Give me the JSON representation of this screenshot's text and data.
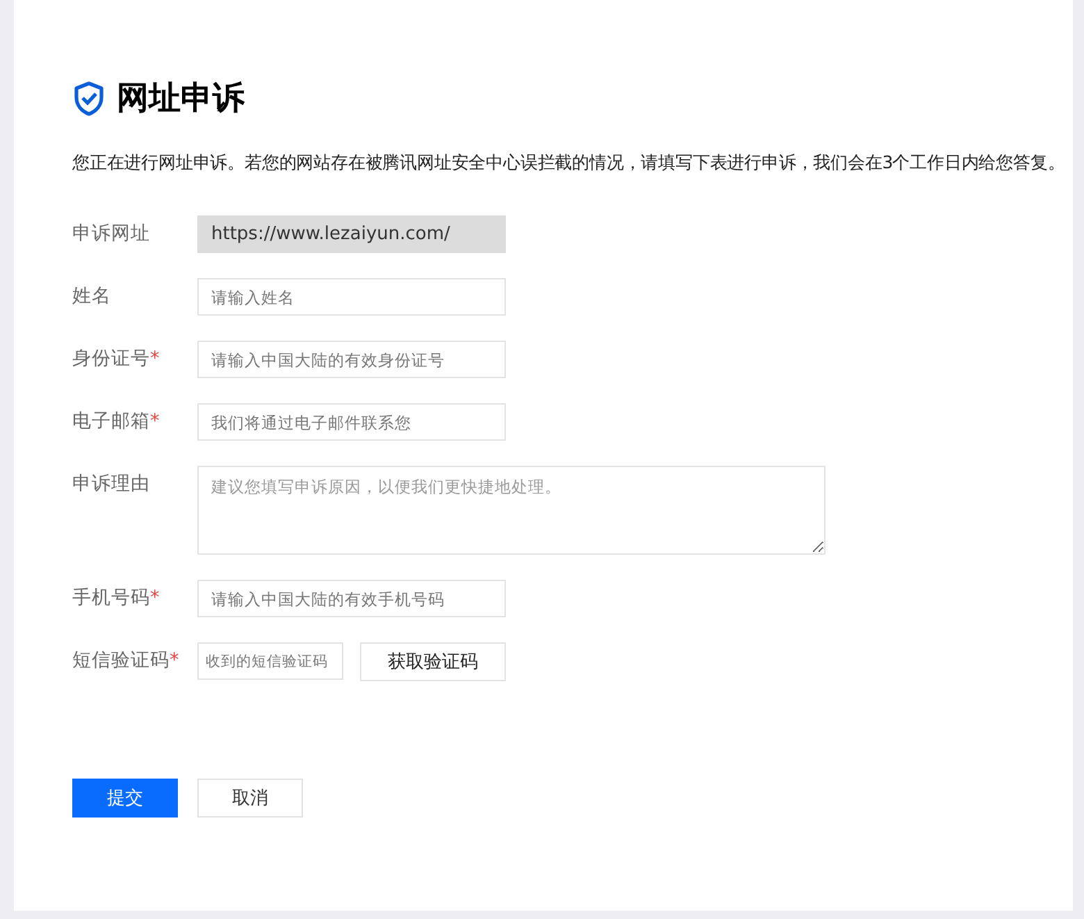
{
  "title": "网址申诉",
  "intro": "您正在进行网址申诉。若您的网站存在被腾讯网址安全中心误拦截的情况，请填写下表进行申诉，我们会在3个工作日内给您答复。",
  "fields": [
    {
      "kind": "readonly",
      "label": "申诉网址",
      "value": "https://www.lezaiyun.com/"
    },
    {
      "kind": "text",
      "label": "姓名",
      "placeholder": "请输入姓名"
    },
    {
      "kind": "text",
      "label": "身份证号",
      "required_mark": "*",
      "placeholder": "请输入中国大陆的有效身份证号"
    },
    {
      "kind": "text",
      "label": "电子邮箱",
      "required_mark": "*",
      "placeholder": "我们将通过电子邮件联系您"
    },
    {
      "kind": "textarea",
      "label": "申诉理由",
      "placeholder": "建议您填写申诉原因，以便我们更快捷地处理。"
    },
    {
      "kind": "text",
      "label": "手机号码",
      "required_mark": "*",
      "placeholder": "请输入中国大陆的有效手机号码"
    },
    {
      "kind": "code",
      "label": "短信验证码",
      "required_mark": "*",
      "placeholder": "收到的短信验证码",
      "button": "获取验证码"
    }
  ],
  "buttons": [
    {
      "kind": "primary",
      "label": "提交"
    },
    {
      "kind": "secondary",
      "label": "取消"
    }
  ]
}
